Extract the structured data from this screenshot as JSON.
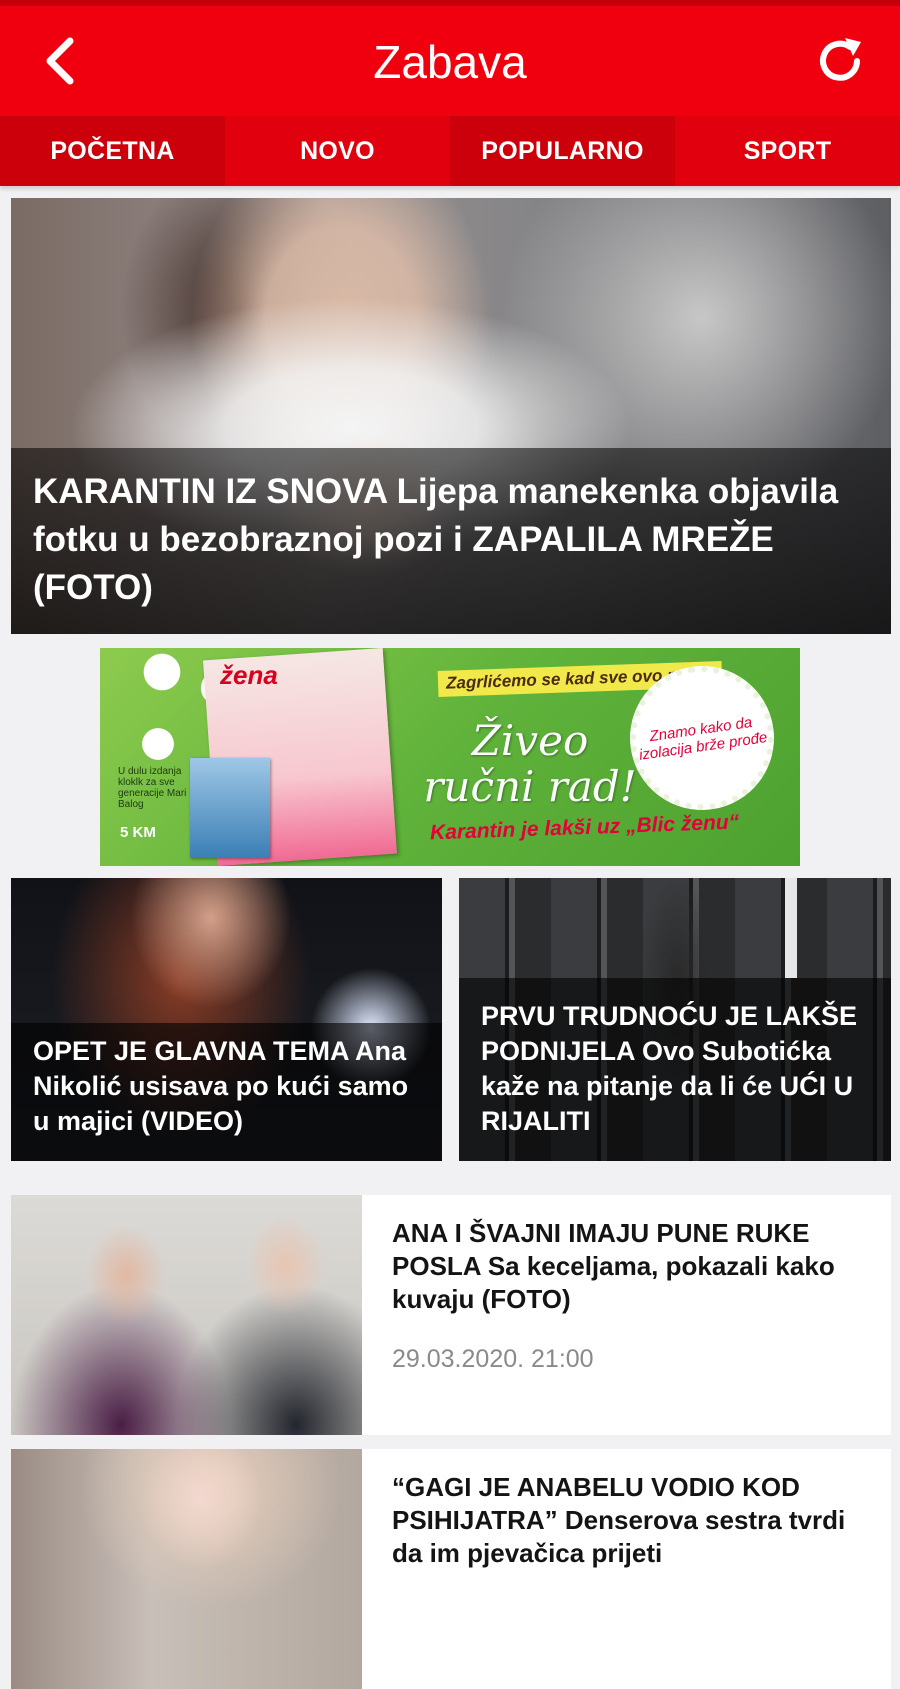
{
  "app_bar": {
    "title": "Zabava",
    "back_icon": "chevron-left-icon",
    "refresh_icon": "refresh-icon",
    "color": "#f0000f"
  },
  "tabs": [
    {
      "label": "POČETNA"
    },
    {
      "label": "NOVO"
    },
    {
      "label": "POPULARNO"
    },
    {
      "label": "SPORT"
    }
  ],
  "hero": {
    "headline": "KARANTIN IZ SNOVA Lijepa manekenka objavila fotku u bezobraznoj pozi i ZAPALILA MREŽE (FOTO)"
  },
  "ad": {
    "magazine_logo": "žena",
    "top_tag": "Zagrlićemo se kad sve ovo prođe",
    "main_text": "Živeo ručni rad!",
    "bottom_text": "Karantin je lakši uz „Blic ženu“",
    "badge_text": "Znamo kako da izolacija brže prođe",
    "price": "5 KM",
    "side_text": "U dulu izdanja kloklk za sve generacije Mari Balog"
  },
  "cards": [
    {
      "headline": "OPET JE GLAVNA TEMA Ana Nikolić usisava po kući samo u majici (VIDEO)"
    },
    {
      "headline": "PRVU TRUDNOĆU JE LAKŠE PODNIJELA Ovo Subotićka kaže na pitanje da li će UĆI U RIJALITI"
    }
  ],
  "list": [
    {
      "title": "ANA I ŠVAJNI IMAJU PUNE RUKE POSLA Sa keceljama, pokazali kako kuvaju (FOTO)",
      "date": "29.03.2020. 21:00"
    },
    {
      "title": "“GAGI JE ANABELU VODIO KOD PSIHIJATRA” Denserova sestra tvrdi da im pjevačica prijeti",
      "date": ""
    }
  ]
}
